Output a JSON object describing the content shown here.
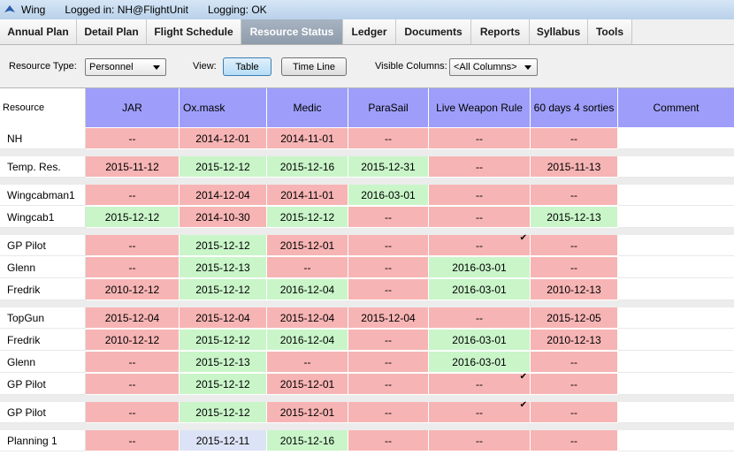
{
  "window": {
    "title": "Wing",
    "login": "Logged in: NH@FlightUnit",
    "logging": "Logging: OK"
  },
  "tabs": [
    {
      "label": "Annual Plan",
      "active": false
    },
    {
      "label": "Detail Plan",
      "active": false
    },
    {
      "label": "Flight Schedule",
      "active": false
    },
    {
      "label": "Resource Status",
      "active": true
    },
    {
      "label": "Ledger",
      "active": false
    },
    {
      "label": "Documents",
      "active": false
    },
    {
      "label": "Reports",
      "active": false
    },
    {
      "label": "Syllabus",
      "active": false
    },
    {
      "label": "Tools",
      "active": false
    }
  ],
  "toolbar": {
    "resource_type_label": "Resource Type:",
    "resource_type_value": "Personnel",
    "view_label": "View:",
    "table_button": "Table",
    "timeline_button": "Time Line",
    "visible_columns_label": "Visible Columns:",
    "visible_columns_value": "<All Columns>"
  },
  "table": {
    "resource_header": "Resource",
    "columns": [
      "JAR",
      "Ox.mask",
      "Medic",
      "ParaSail",
      "Live Weapon Rule",
      "60 days 4 sorties",
      "Comment"
    ],
    "colors": {
      "red": "#f7b4b4",
      "green": "#c9f5c9",
      "blue": "#dde3f6",
      "header": "#9e9efa"
    },
    "groups": [
      [
        {
          "name": "NH",
          "cells": [
            [
              "--",
              "r"
            ],
            [
              "2014-12-01",
              "r"
            ],
            [
              "2014-11-01",
              "r"
            ],
            [
              "--",
              "r"
            ],
            [
              "--",
              "r"
            ],
            [
              "--",
              "r"
            ]
          ]
        }
      ],
      [
        {
          "name": "Temp. Res.",
          "cells": [
            [
              "2015-11-12",
              "r"
            ],
            [
              "2015-12-12",
              "g"
            ],
            [
              "2015-12-16",
              "g"
            ],
            [
              "2015-12-31",
              "g"
            ],
            [
              "--",
              "r"
            ],
            [
              "2015-11-13",
              "r"
            ]
          ]
        }
      ],
      [
        {
          "name": "Wingcabman1",
          "cells": [
            [
              "--",
              "r"
            ],
            [
              "2014-12-04",
              "r"
            ],
            [
              "2014-11-01",
              "r"
            ],
            [
              "2016-03-01",
              "g"
            ],
            [
              "--",
              "r"
            ],
            [
              "--",
              "r"
            ]
          ]
        },
        {
          "name": "Wingcab1",
          "cells": [
            [
              "2015-12-12",
              "g"
            ],
            [
              "2014-10-30",
              "r"
            ],
            [
              "2015-12-12",
              "g"
            ],
            [
              "--",
              "r"
            ],
            [
              "--",
              "r"
            ],
            [
              "2015-12-13",
              "g"
            ]
          ]
        }
      ],
      [
        {
          "name": "GP Pilot",
          "cells": [
            [
              "--",
              "r"
            ],
            [
              "2015-12-12",
              "g"
            ],
            [
              "2015-12-01",
              "r"
            ],
            [
              "--",
              "r"
            ],
            [
              "--",
              "r",
              "check"
            ],
            [
              "--",
              "r"
            ]
          ]
        },
        {
          "name": "Glenn",
          "cells": [
            [
              "--",
              "r"
            ],
            [
              "2015-12-13",
              "g"
            ],
            [
              "--",
              "r"
            ],
            [
              "--",
              "r"
            ],
            [
              "2016-03-01",
              "g"
            ],
            [
              "--",
              "r"
            ]
          ]
        },
        {
          "name": "Fredrik",
          "cells": [
            [
              "2010-12-12",
              "r"
            ],
            [
              "2015-12-12",
              "g"
            ],
            [
              "2016-12-04",
              "g"
            ],
            [
              "--",
              "r"
            ],
            [
              "2016-03-01",
              "g"
            ],
            [
              "2010-12-13",
              "r"
            ]
          ]
        }
      ],
      [
        {
          "name": "TopGun",
          "cells": [
            [
              "2015-12-04",
              "r"
            ],
            [
              "2015-12-04",
              "r"
            ],
            [
              "2015-12-04",
              "r"
            ],
            [
              "2015-12-04",
              "r"
            ],
            [
              "--",
              "r"
            ],
            [
              "2015-12-05",
              "r"
            ]
          ]
        },
        {
          "name": "Fredrik",
          "cells": [
            [
              "2010-12-12",
              "r"
            ],
            [
              "2015-12-12",
              "g"
            ],
            [
              "2016-12-04",
              "g"
            ],
            [
              "--",
              "r"
            ],
            [
              "2016-03-01",
              "g"
            ],
            [
              "2010-12-13",
              "r"
            ]
          ]
        },
        {
          "name": "Glenn",
          "cells": [
            [
              "--",
              "r"
            ],
            [
              "2015-12-13",
              "g"
            ],
            [
              "--",
              "r"
            ],
            [
              "--",
              "r"
            ],
            [
              "2016-03-01",
              "g"
            ],
            [
              "--",
              "r"
            ]
          ]
        },
        {
          "name": "GP Pilot",
          "cells": [
            [
              "--",
              "r"
            ],
            [
              "2015-12-12",
              "g"
            ],
            [
              "2015-12-01",
              "r"
            ],
            [
              "--",
              "r"
            ],
            [
              "--",
              "r",
              "check"
            ],
            [
              "--",
              "r"
            ]
          ]
        }
      ],
      [
        {
          "name": "GP Pilot",
          "cells": [
            [
              "--",
              "r"
            ],
            [
              "2015-12-12",
              "g"
            ],
            [
              "2015-12-01",
              "r"
            ],
            [
              "--",
              "r"
            ],
            [
              "--",
              "r",
              "check"
            ],
            [
              "--",
              "r"
            ]
          ]
        }
      ],
      [
        {
          "name": "Planning 1",
          "cells": [
            [
              "--",
              "r"
            ],
            [
              "2015-12-11",
              "b"
            ],
            [
              "2015-12-16",
              "g"
            ],
            [
              "--",
              "r"
            ],
            [
              "--",
              "r"
            ],
            [
              "--",
              "r"
            ]
          ]
        }
      ]
    ]
  }
}
